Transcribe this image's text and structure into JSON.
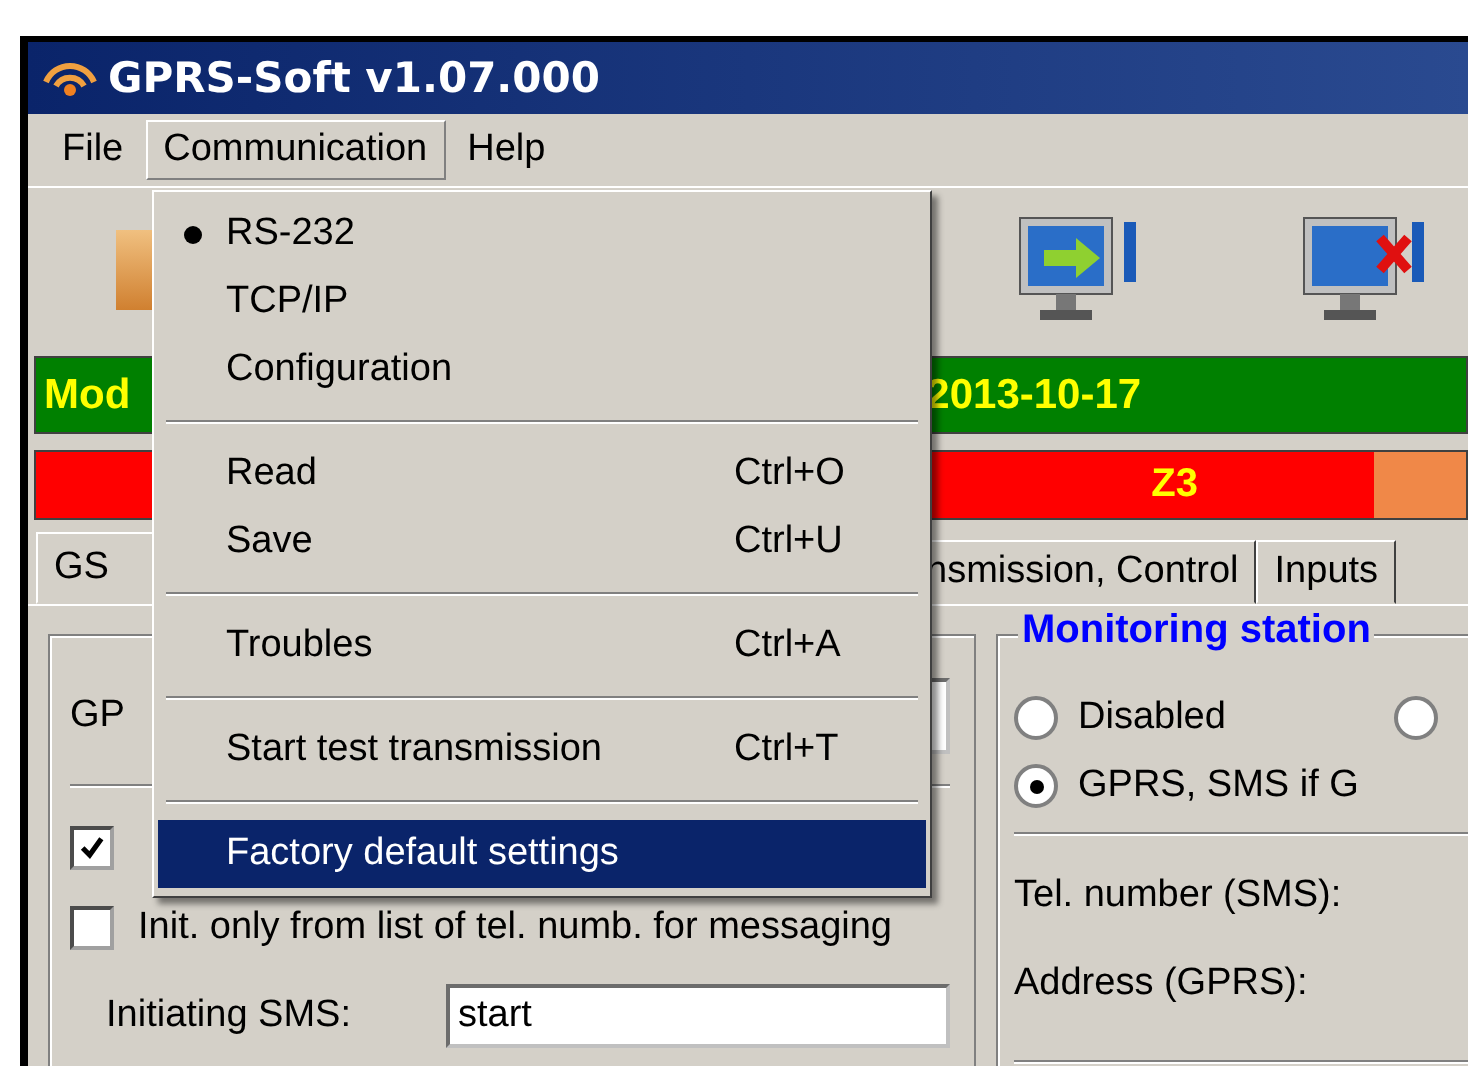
{
  "window": {
    "title": "GPRS-Soft v1.07.000"
  },
  "menu_bar": [
    {
      "label": "File",
      "selected": false
    },
    {
      "label": "Communication",
      "selected": true
    },
    {
      "label": "Help",
      "selected": false
    }
  ],
  "status_bar": {
    "text": "Mod",
    "date": "2013-10-17"
  },
  "zone_bar": {
    "label": "Z3"
  },
  "tabs": [
    {
      "label": "GS",
      "selected": true
    },
    {
      "label": "nsmission, Control",
      "selected": false
    },
    {
      "label": "Inputs",
      "selected": false
    }
  ],
  "left_panel": {
    "field_label": "GP",
    "checkboxes": [
      {
        "checked": true
      },
      {
        "label": "Init. only from list of tel. numb. for messaging",
        "checked": false
      }
    ],
    "initiating_sms": {
      "label": "Initiating SMS:",
      "value": "start"
    }
  },
  "monitoring": {
    "title": "Monitoring station",
    "options": [
      {
        "label": "Disabled",
        "selected": false
      },
      {
        "selected": false
      },
      {
        "label": "GPRS, SMS if G",
        "selected": true
      }
    ],
    "fields": [
      "Tel. number (SMS):",
      "Address (GPRS):"
    ]
  },
  "dropdown": {
    "items": [
      {
        "kind": "radio",
        "label": "RS-232",
        "checked": true,
        "selected": false
      },
      {
        "kind": "radio",
        "label": "TCP/IP",
        "checked": false,
        "selected": false
      },
      {
        "kind": "item",
        "label": "Configuration",
        "selected": false
      },
      {
        "kind": "separator"
      },
      {
        "kind": "item",
        "label": "Read",
        "shortcut": "Ctrl+O",
        "selected": false
      },
      {
        "kind": "item",
        "label": "Save",
        "shortcut": "Ctrl+U",
        "selected": false
      },
      {
        "kind": "separator"
      },
      {
        "kind": "item",
        "label": "Troubles",
        "shortcut": "Ctrl+A",
        "selected": false
      },
      {
        "kind": "separator"
      },
      {
        "kind": "item",
        "label": "Start test transmission",
        "shortcut": "Ctrl+T",
        "selected": false
      },
      {
        "kind": "separator"
      },
      {
        "kind": "item",
        "label": "Factory default settings",
        "selected": true
      }
    ]
  }
}
